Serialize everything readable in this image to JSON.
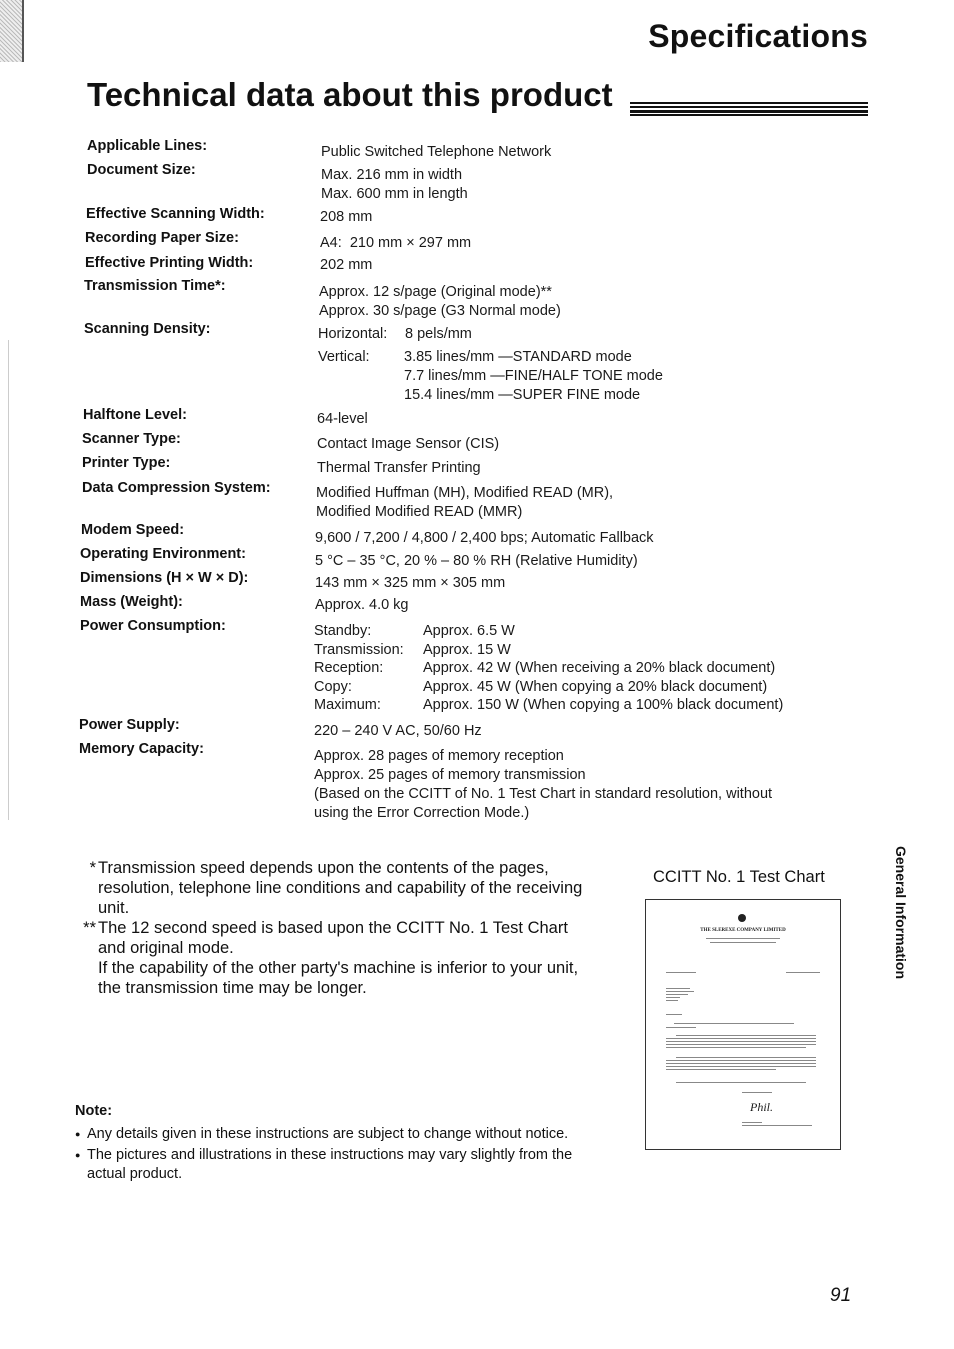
{
  "header": {
    "section_title": "Specifications",
    "page_heading": "Technical data about this product"
  },
  "specs": [
    {
      "label": "Applicable Lines:",
      "values": [
        "Public Switched Telephone Network"
      ]
    },
    {
      "label": "Document Size:",
      "values": [
        "Max. 216 mm in width",
        "Max. 600 mm in length"
      ]
    },
    {
      "label": "Effective Scanning Width:",
      "values": [
        "208 mm"
      ]
    },
    {
      "label": "Recording Paper Size:",
      "values": [
        "A4:  210 mm × 297 mm"
      ]
    },
    {
      "label": "Effective Printing Width:",
      "values": [
        "202 mm"
      ]
    },
    {
      "label": "Transmission Time*:",
      "values": [
        "Approx. 12 s/page (Original mode)**",
        "Approx. 30 s/page (G3 Normal mode)"
      ]
    },
    {
      "label": "Scanning Density:",
      "horizontal": {
        "key": "Horizontal:",
        "value": "8 pels/mm"
      },
      "vertical": {
        "key": "Vertical:",
        "values": [
          "3.85 lines/mm —STANDARD mode",
          "7.7 lines/mm —FINE/HALF TONE mode",
          "15.4 lines/mm —SUPER FINE mode"
        ]
      }
    },
    {
      "label": "Halftone Level:",
      "values": [
        "64-level"
      ]
    },
    {
      "label": "Scanner Type:",
      "values": [
        "Contact Image Sensor (CIS)"
      ]
    },
    {
      "label": "Printer Type:",
      "values": [
        "Thermal Transfer Printing"
      ]
    },
    {
      "label": "Data Compression System:",
      "values": [
        "Modified Huffman (MH), Modified READ (MR),",
        "Modified Modified READ (MMR)"
      ]
    },
    {
      "label": "Modem Speed:",
      "values": [
        "9,600 / 7,200 / 4,800 / 2,400 bps; Automatic Fallback"
      ]
    },
    {
      "label": "Operating Environment:",
      "values": [
        "5 °C – 35 °C, 20 % – 80 % RH (Relative Humidity)"
      ]
    },
    {
      "label": "Dimensions (H × W × D):",
      "values": [
        "143 mm × 325 mm × 305 mm"
      ]
    },
    {
      "label": "Mass (Weight):",
      "values": [
        "Approx. 4.0 kg"
      ]
    },
    {
      "label": "Power Consumption:",
      "rows": [
        {
          "key": "Standby:",
          "value": "Approx. 6.5 W"
        },
        {
          "key": "Transmission:",
          "value": "Approx. 15 W"
        },
        {
          "key": "Reception:",
          "value": "Approx. 42 W (When receiving a 20% black document)"
        },
        {
          "key": "Copy:",
          "value": "Approx. 45 W (When copying a 20% black document)"
        },
        {
          "key": "Maximum:",
          "value": "Approx. 150 W (When copying a 100% black document)"
        }
      ]
    },
    {
      "label": "Power Supply:",
      "values": [
        "220 – 240 V AC, 50/60 Hz"
      ]
    },
    {
      "label": "Memory Capacity:",
      "values": [
        "Approx. 28 pages of memory reception",
        "Approx. 25 pages of memory transmission",
        "(Based on the CCITT of No. 1 Test Chart in standard resolution, without",
        "using the Error Correction Mode.)"
      ]
    }
  ],
  "footnotes": [
    {
      "mark": "*",
      "lines": [
        "Transmission speed depends upon the contents of the pages, resolution, telephone line conditions and capability of the receiving unit."
      ]
    },
    {
      "mark": "**",
      "lines": [
        "The 12 second speed is based upon the CCITT No. 1 Test Chart and original mode.",
        "If the capability of the other party's machine is inferior to your unit, the transmission time may be longer."
      ]
    }
  ],
  "test_chart": {
    "caption": "CCITT No. 1 Test Chart",
    "letterhead": "THE SLEREXE COMPANY LIMITED",
    "signature": "Phil."
  },
  "side_tab": "General Information",
  "note": {
    "title": "Note:",
    "bullets": [
      "Any details given in these instructions are subject to change without notice.",
      "The pictures and illustrations in these instructions may vary slightly from the actual product."
    ]
  },
  "page_number": "91"
}
